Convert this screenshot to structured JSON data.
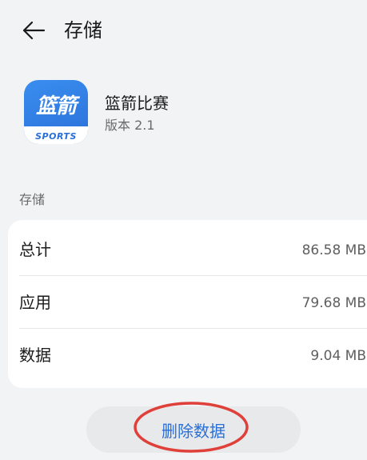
{
  "header": {
    "title": "存储"
  },
  "app": {
    "name": "篮箭比赛",
    "version": "版本 2.1",
    "icon_text": "篮箭",
    "icon_subtext": "SPORTS",
    "icon_color": "#2a6fd8"
  },
  "storage": {
    "section_label": "存储",
    "rows": [
      {
        "label": "总计",
        "value": "86.58 MB"
      },
      {
        "label": "应用",
        "value": "79.68 MB"
      },
      {
        "label": "数据",
        "value": "9.04 MB"
      }
    ]
  },
  "actions": {
    "clear_data_label": "删除数据",
    "accent_color": "#2a6fd8",
    "highlight_color": "#e0403a"
  }
}
